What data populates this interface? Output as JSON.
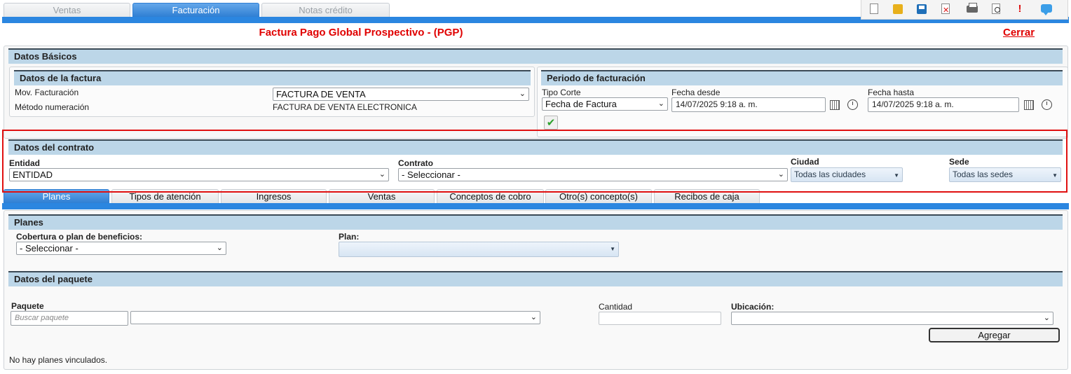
{
  "top_tabs": [
    "Ventas",
    "Facturación",
    "Notas crédito"
  ],
  "toolbar": {
    "icons": [
      "new-document-icon",
      "open-folder-icon",
      "save-icon",
      "delete-document-icon",
      "print-icon",
      "preview-icon",
      "alert-icon",
      "chat-icon"
    ]
  },
  "page_title": "Factura Pago Global Prospectivo - (PGP)",
  "close_label": "Cerrar",
  "basic": {
    "section_title": "Datos Básicos",
    "invoice": {
      "title": "Datos de la factura",
      "mov_label": "Mov. Facturación",
      "mov_value": "FACTURA DE VENTA",
      "num_label": "Método numeración",
      "num_value": "FACTURA DE VENTA ELECTRONICA"
    },
    "period": {
      "title": "Periodo de facturación",
      "cut_label": "Tipo Corte",
      "cut_value": "Fecha de Factura",
      "from_label": "Fecha desde",
      "from_value": "14/07/2025 9:18 a. m.",
      "to_label": "Fecha hasta",
      "to_value": "14/07/2025 9:18 a. m."
    }
  },
  "contract": {
    "title": "Datos del contrato",
    "entity_label": "Entidad",
    "entity_value": "ENTIDAD",
    "contract_label": "Contrato",
    "contract_value": "- Seleccionar -",
    "city_label": "Ciudad",
    "city_value": "Todas las ciudades",
    "site_label": "Sede",
    "site_value": "Todas las sedes"
  },
  "mid_tabs": [
    "Planes",
    "Tipos de atención",
    "Ingresos",
    "Ventas",
    "Conceptos de cobro",
    "Otro(s) concepto(s)",
    "Recibos de caja"
  ],
  "plans": {
    "title": "Planes",
    "coverage_label": "Cobertura o plan de beneficios:",
    "coverage_value": "- Seleccionar -",
    "plan_label": "Plan:",
    "plan_value": ""
  },
  "package": {
    "title": "Datos del paquete",
    "package_label": "Paquete",
    "search_placeholder": "Buscar paquete",
    "package_select_value": "",
    "qty_label": "Cantidad",
    "qty_value": "",
    "location_label": "Ubicación:",
    "location_value": "",
    "add_label": "Agregar",
    "empty_message": "No hay planes vinculados."
  }
}
